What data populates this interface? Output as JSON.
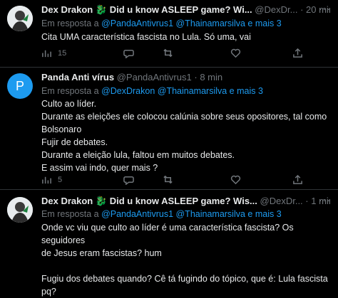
{
  "tweets": [
    {
      "name": "Dex Drakon",
      "name_suffix": "Did u know ASLEEP game? Wi...",
      "handle": "@DexDr...",
      "sep": "·",
      "time": "20 min",
      "reply_prefix": "Em resposta a",
      "reply_mentions": "@PandaAntivrus1 @Thainamarsilva e mais 3",
      "lines": [
        "Cita UMA característica fascista no Lula. Só uma, vai"
      ],
      "views": "15"
    },
    {
      "name": "Panda Anti vírus",
      "avatar_letter": "P",
      "handle": "@PandaAntivrus1",
      "sep": "·",
      "time": "8 min",
      "reply_prefix": "Em resposta a",
      "reply_mentions": "@DexDrakon @Thainamarsilva e mais 3",
      "lines": [
        "Culto ao líder.",
        "Durante as eleições ele colocou calúnia sobre seus opositores, tal como",
        "Bolsonaro",
        "Fujir de debates.",
        "Durante a eleição lula, faltou em muitos debates.",
        "E assim vai indo, quer mais ?"
      ],
      "views": "5"
    },
    {
      "name": "Dex Drakon",
      "name_suffix": "Did u know ASLEEP game? Wis...",
      "handle": "@DexDr...",
      "sep": "·",
      "time": "1 min",
      "reply_prefix": "Em resposta a",
      "reply_mentions": "@PandaAntivrus1 @Thainamarsilva e mais 3",
      "lines": [
        "Onde vc viu que culto ao líder é uma característica fascista? Os seguidores",
        "de Jesus eram fascistas? hum",
        "",
        "Fugiu dos debates quando? Cê tá fugindo do tópico, que é: Lula fascista",
        "pq?"
      ]
    }
  ],
  "more_label": "···",
  "icons": [
    "dragon-icon",
    "views-icon",
    "reply-icon",
    "retweet-icon",
    "like-icon",
    "share-icon",
    "more-icon"
  ],
  "colors": {
    "background": "#000000",
    "text": "#e7e9ea",
    "muted": "#71767b",
    "link": "#1d9bf0",
    "avatar_p": "#1d9bf0"
  }
}
